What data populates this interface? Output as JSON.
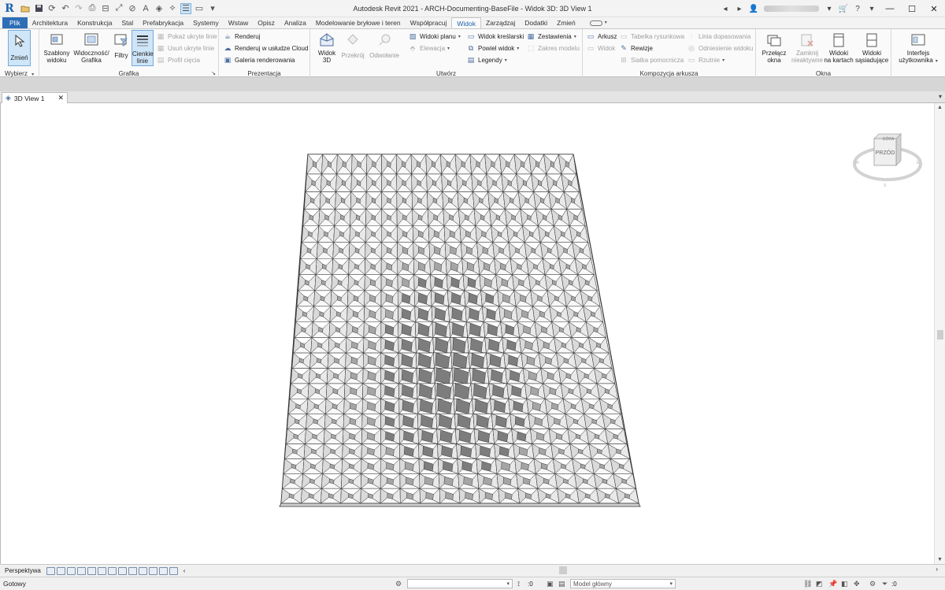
{
  "app": {
    "title": "Autodesk Revit 2021 - ARCH-Documenting-BaseFile - Widok 3D: 3D View 1"
  },
  "title_right": {
    "user_icon": "user-icon",
    "cart_icon": "cart-icon",
    "help_label": "?"
  },
  "ribbon_tabs": [
    {
      "label": "Plik"
    },
    {
      "label": "Architektura"
    },
    {
      "label": "Konstrukcja"
    },
    {
      "label": "Stal"
    },
    {
      "label": "Prefabrykacja"
    },
    {
      "label": "Systemy"
    },
    {
      "label": "Wstaw"
    },
    {
      "label": "Opisz"
    },
    {
      "label": "Analiza"
    },
    {
      "label": "Modelowanie bryłowe i teren"
    },
    {
      "label": "Współpracuj"
    },
    {
      "label": "Widok"
    },
    {
      "label": "Zarządzaj"
    },
    {
      "label": "Dodatki"
    },
    {
      "label": "Zmień"
    }
  ],
  "ribbon": {
    "wybierz": {
      "modify": "Zmień",
      "panel": "Wybierz"
    },
    "grafika": {
      "panel": "Grafika",
      "szablony_1": "Szablony",
      "szablony_2": "widoku",
      "widocznosc_1": "Widoczność/",
      "widocznosc_2": "Grafika",
      "filtry": "Filtry",
      "cienkie_1": "Cienkie",
      "cienkie_2": "linie",
      "pokaz": "Pokaż ukryte linie",
      "usun": "Usuń ukryte linie",
      "profil": "Profil cięcia"
    },
    "prezentacja": {
      "panel": "Prezentacja",
      "renderuj": "Renderuj",
      "renderuj_cloud": "Renderuj w  usłudze Cloud",
      "galeria": "Galeria  renderowania"
    },
    "utworz": {
      "panel": "Utwórz",
      "widok3d_1": "Widok",
      "widok3d_2": "3D",
      "przekroj": "Przekrój",
      "odwolanie": "Odwołanie",
      "widoki_planu": "Widoki planu",
      "elewacja": "Elewacja",
      "widok_kreslarski": "Widok kreślarski",
      "powiel_widok": "Powiel widok",
      "legendy": "Legendy",
      "zestawienia": "Zestawienia",
      "zakres_modelu": "Zakres modelu"
    },
    "kompozycja": {
      "panel": "Kompozycja arkusza",
      "arkusz": "Arkusz",
      "widok": "Widok",
      "tabelka": "Tabelka rysunkowa",
      "rewizje": "Rewizje",
      "siatka": "Siatka pomocnicza",
      "linia": "Linia dopasowania",
      "odniesienie": "Odniesienie widoku",
      "rzutnie": "Rzutnie"
    },
    "okna": {
      "panel": "Okna",
      "przelacz_1": "Przełącz",
      "przelacz_2": "okna",
      "zamknij_1": "Zamknij",
      "zamknij_2": "nieaktywne",
      "widoki_kart_1": "Widoki",
      "widoki_kart_2": "na kartach",
      "widoki_sas_1": "Widoki",
      "widoki_sas_2": "sąsiadujące"
    },
    "interfejs": {
      "label_1": "Interfejs",
      "label_2": "użytkownika"
    }
  },
  "view_tab": {
    "label": "3D View 1"
  },
  "viewcube": {
    "top": "GÓRA",
    "front": "PRZÓD"
  },
  "view_control": {
    "label": "Perspektywa"
  },
  "status": {
    "text": "Gotowy",
    "selection_count": ":0",
    "model_label": "Model główny",
    "filter_count": ":0"
  },
  "colors": {
    "accent": "#2d6eb6",
    "selected_fill": "#cfe5f8",
    "selected_border": "#77aadb"
  }
}
